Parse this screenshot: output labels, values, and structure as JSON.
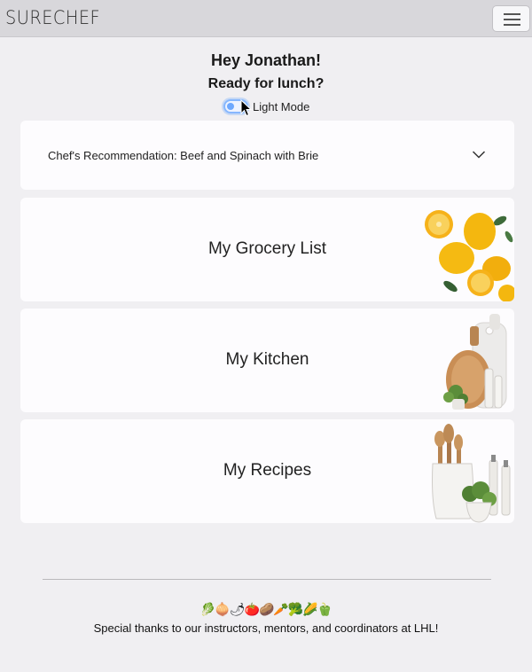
{
  "navbar": {
    "brand": "SURECHEF",
    "menu_icon": "hamburger-icon"
  },
  "greeting": {
    "hello": "Hey Jonathan!",
    "prompt": "Ready for lunch?"
  },
  "theme_toggle": {
    "label": "Light Mode",
    "state": "light"
  },
  "recommendation": {
    "label": "Chef's Recommendation: Beef and Spinach with Brie",
    "icon": "chevron-down-icon"
  },
  "cards": [
    {
      "title": "My Grocery List",
      "image": "lemons-image"
    },
    {
      "title": "My Kitchen",
      "image": "cutting-boards-image"
    },
    {
      "title": "My Recipes",
      "image": "utensils-jar-image"
    }
  ],
  "footer": {
    "emojis": "🥬🧅🌶🍅🥔🥕🥦🌽🫑",
    "thanks": "Special thanks to our instructors, mentors, and coordinators at LHL!"
  },
  "colors": {
    "background": "#f0eff2",
    "navbar": "#d8d7db",
    "card": "#fdfcfe",
    "switch_accent": "#86b7fe"
  }
}
